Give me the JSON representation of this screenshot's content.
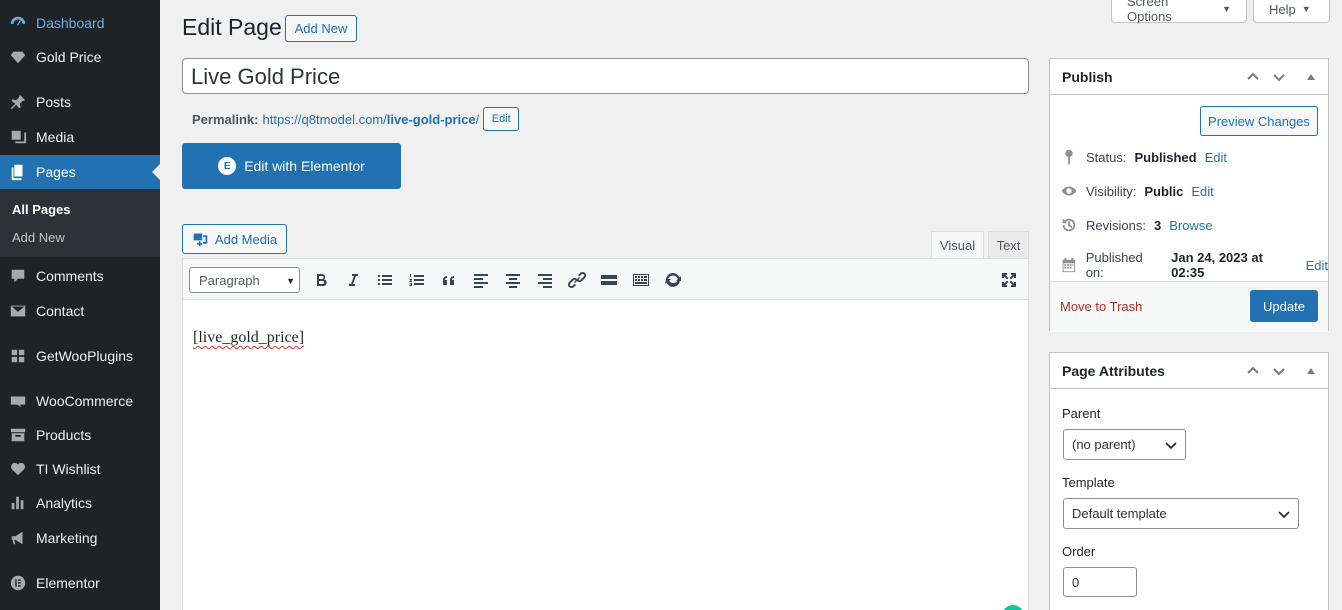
{
  "sidebar": {
    "items": [
      {
        "label": "Dashboard",
        "icon": "dashboard-icon"
      },
      {
        "label": "Gold Price",
        "icon": "diamond-icon"
      },
      {
        "label": "Posts",
        "icon": "pin-icon"
      },
      {
        "label": "Media",
        "icon": "media-icon"
      },
      {
        "label": "Pages",
        "icon": "pages-icon"
      },
      {
        "label": "Comments",
        "icon": "comment-icon"
      },
      {
        "label": "Contact",
        "icon": "mail-icon"
      },
      {
        "label": "GetWooPlugins",
        "icon": "plugin-grid-icon"
      },
      {
        "label": "WooCommerce",
        "icon": "woo-icon"
      },
      {
        "label": "Products",
        "icon": "archive-icon"
      },
      {
        "label": "TI Wishlist",
        "icon": "heart-icon"
      },
      {
        "label": "Analytics",
        "icon": "bar-chart-icon"
      },
      {
        "label": "Marketing",
        "icon": "megaphone-icon"
      },
      {
        "label": "Elementor",
        "icon": "elementor-icon"
      }
    ],
    "submenu": [
      {
        "label": "All Pages"
      },
      {
        "label": "Add New"
      }
    ]
  },
  "top_buttons": {
    "screen_options": "Screen Options",
    "help": "Help"
  },
  "header": {
    "title": "Edit Page",
    "add_new": "Add New"
  },
  "post": {
    "title": "Live Gold Price",
    "permalink_label": "Permalink:",
    "permalink_base": "https://q8tmodel.com/",
    "permalink_slug": "live-gold-price",
    "permalink_trail": "/",
    "permalink_edit": "Edit",
    "elementor_button": "Edit with Elementor"
  },
  "editor": {
    "add_media": "Add Media",
    "tab_visual": "Visual",
    "tab_text": "Text",
    "format": "Paragraph",
    "toolbar_icons": [
      "bold-icon",
      "italic-icon",
      "bullet-list-icon",
      "numbered-list-icon",
      "blockquote-icon",
      "align-left-icon",
      "align-center-icon",
      "align-right-icon",
      "link-icon",
      "read-more-icon",
      "toolbar-toggle-icon",
      "refresh-icon",
      "fullscreen-icon"
    ],
    "content": "[live_gold_price]"
  },
  "publish": {
    "title": "Publish",
    "preview": "Preview Changes",
    "status_label": "Status:",
    "status_value": "Published",
    "visibility_label": "Visibility:",
    "visibility_value": "Public",
    "revisions_label": "Revisions:",
    "revisions_value": "3",
    "revisions_link": "Browse",
    "published_label": "Published on:",
    "published_value": "Jan 24, 2023 at 02:35",
    "edit": "Edit",
    "trash": "Move to Trash",
    "update": "Update"
  },
  "page_attributes": {
    "title": "Page Attributes",
    "parent_label": "Parent",
    "parent_value": "(no parent)",
    "template_label": "Template",
    "template_value": "Default template",
    "order_label": "Order",
    "order_value": "0"
  },
  "colors": {
    "admin_menu_bg": "#1d2327",
    "accent": "#2271b1",
    "trash": "#b32d2e"
  }
}
